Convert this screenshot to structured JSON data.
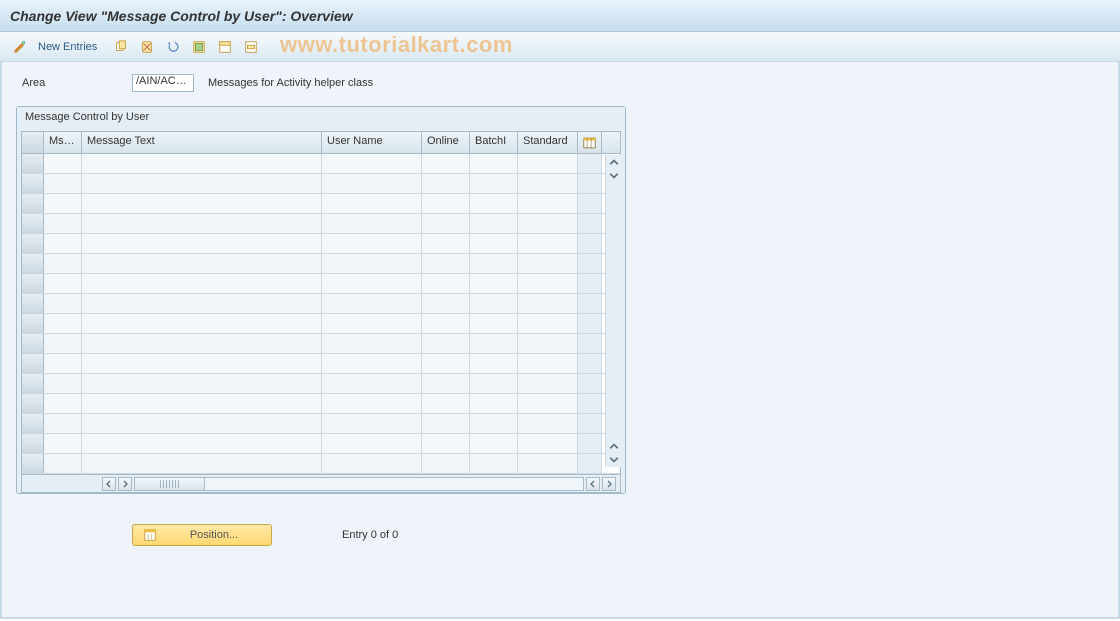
{
  "title": "Change View \"Message Control by User\": Overview",
  "toolbar": {
    "new_entries": "New Entries"
  },
  "watermark": "www.tutorialkart.com",
  "filter": {
    "area_label": "Area",
    "area_value": "/AIN/AC…",
    "area_desc": "Messages for Activity helper class"
  },
  "panel": {
    "title": "Message Control by User",
    "columns": {
      "msg": "Msg...",
      "text": "Message Text",
      "user": "User Name",
      "online": "Online",
      "batch": "BatchI",
      "standard": "Standard"
    }
  },
  "footer": {
    "position_label": "Position...",
    "entry_text": "Entry 0 of 0"
  }
}
